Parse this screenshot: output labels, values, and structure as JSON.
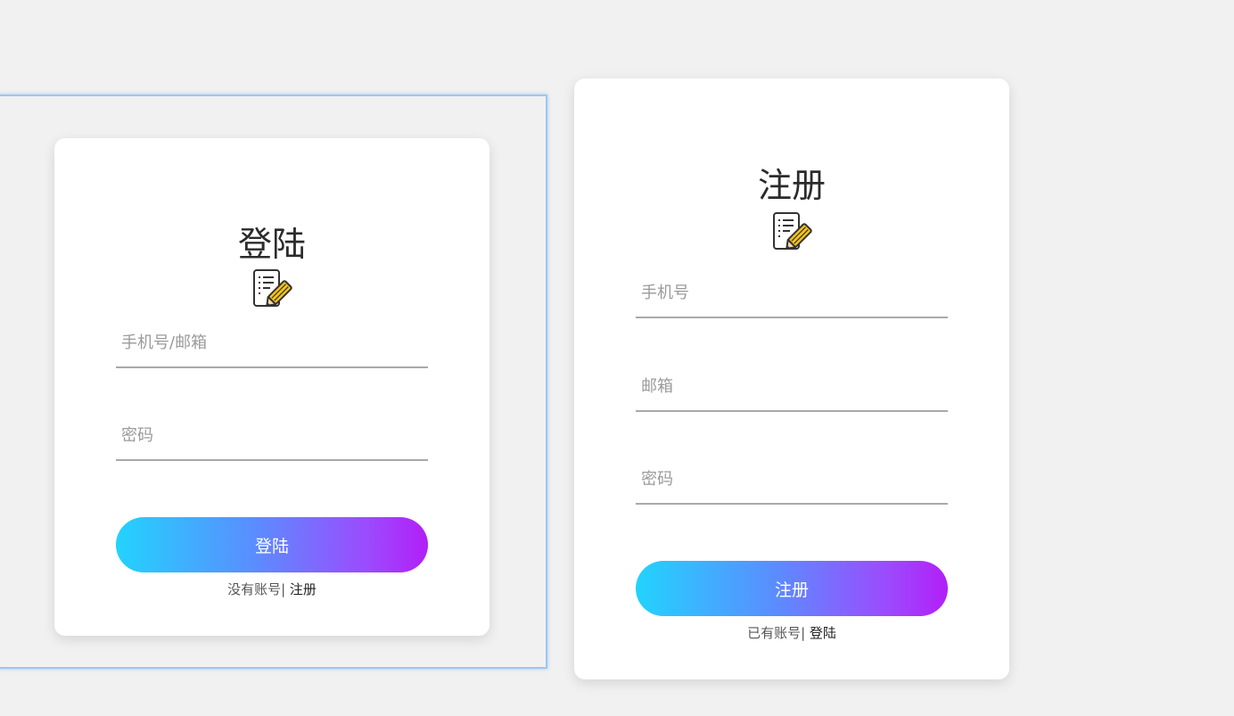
{
  "login": {
    "title": "登陆",
    "icon": "edit-document-icon",
    "account_placeholder": "手机号/邮箱",
    "password_placeholder": "密码",
    "submit_label": "登陆",
    "switch_prefix": "没有账号|",
    "switch_link": "注册"
  },
  "register": {
    "title": "注册",
    "icon": "edit-document-icon",
    "phone_placeholder": "手机号",
    "email_placeholder": "邮箱",
    "password_placeholder": "密码",
    "submit_label": "注册",
    "switch_prefix": "已有账号|",
    "switch_link": "登陆"
  },
  "colors": {
    "background": "#f1f1f1",
    "card": "#ffffff",
    "gradient_start": "#22d3fd",
    "gradient_end": "#b21ff8",
    "selection_border": "#9cc7f2"
  }
}
